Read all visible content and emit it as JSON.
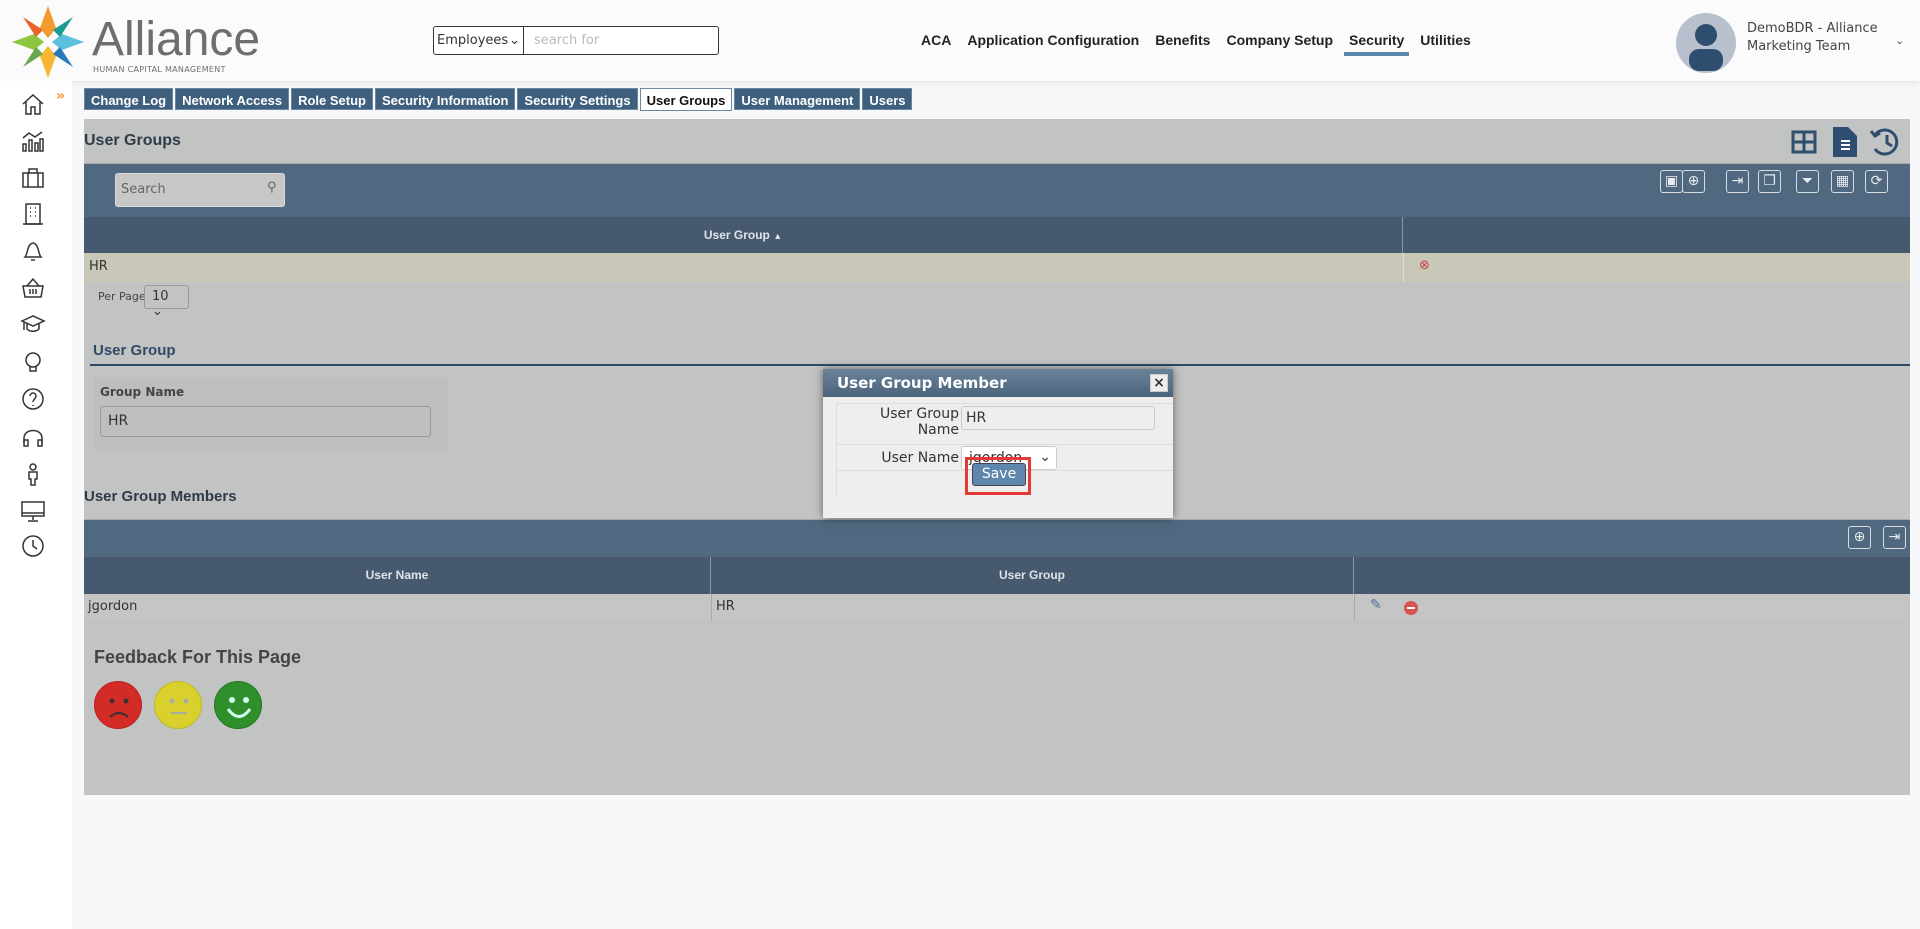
{
  "brand": {
    "name": "Alliance",
    "tagline": "HUMAN CAPITAL MANAGEMENT"
  },
  "search": {
    "scope": "Employees",
    "placeholder": "search for"
  },
  "nav": [
    {
      "label": "ACA"
    },
    {
      "label": "Application Configuration"
    },
    {
      "label": "Benefits"
    },
    {
      "label": "Company Setup"
    },
    {
      "label": "Security",
      "active": true
    },
    {
      "label": "Utilities"
    }
  ],
  "user": {
    "name": "DemoBDR - Alliance Marketing Team"
  },
  "sidebar": [
    "home-icon",
    "analytics-icon",
    "briefcase-icon",
    "building-icon",
    "bell-icon",
    "basket-icon",
    "graduation-cap-icon",
    "lightbulb-icon",
    "help-icon",
    "headphones-icon",
    "person-icon",
    "monitor-icon",
    "clock-icon"
  ],
  "tabs": [
    {
      "label": "Change Log"
    },
    {
      "label": "Network Access"
    },
    {
      "label": "Role Setup"
    },
    {
      "label": "Security Information"
    },
    {
      "label": "Security Settings"
    },
    {
      "label": "User Groups",
      "active": true
    },
    {
      "label": "User Management"
    },
    {
      "label": "Users"
    }
  ],
  "user_groups": {
    "title": "User Groups",
    "search_placeholder": "Search",
    "column": "User Group",
    "sort": "▲",
    "rows": [
      {
        "name": "HR"
      }
    ],
    "per_page_label": "Per Page",
    "per_page": "10"
  },
  "user_group": {
    "title": "User Group",
    "group_name_label": "Group Name",
    "group_name": "HR"
  },
  "members": {
    "title": "User Group Members",
    "columns": [
      "User Name",
      "User Group"
    ],
    "rows": [
      {
        "user": "jgordon",
        "group": "HR"
      }
    ]
  },
  "feedback": {
    "title": "Feedback For This Page"
  },
  "modal": {
    "title": "User Group Member",
    "group_label": "User Group Name",
    "group_value": "HR",
    "user_label": "User Name",
    "user_value": "jgordon",
    "save": "Save",
    "close": "×"
  },
  "colors": {
    "accent": "#3f5f7f",
    "toolbar": "#516980",
    "selected_row": "#c8c7b8",
    "highlight": "#e53935"
  }
}
